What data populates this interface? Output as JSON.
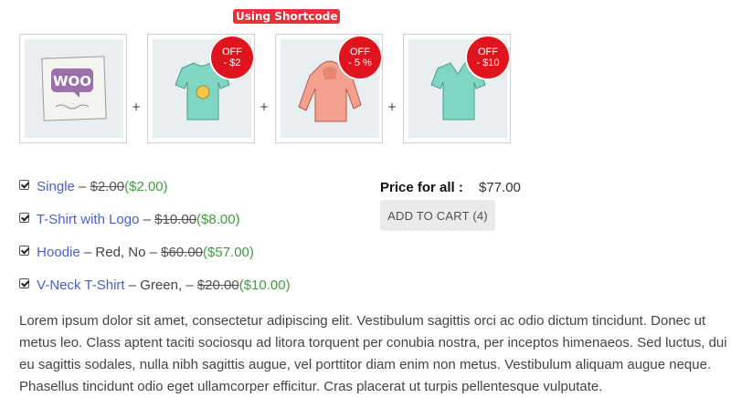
{
  "banner": "Using Shortcode",
  "products": [
    {
      "name": "Single",
      "image_icon": "woo-album-icon",
      "badge": null
    },
    {
      "name": "T-Shirt with Logo",
      "image_icon": "tshirt-logo-icon",
      "badge": {
        "line1": "OFF",
        "line2": "- $2"
      }
    },
    {
      "name": "Hoodie",
      "image_icon": "hoodie-icon",
      "badge": {
        "line1": "OFF",
        "line2": "- 5 %"
      }
    },
    {
      "name": "V-Neck T-Shirt",
      "image_icon": "vneck-tshirt-icon",
      "badge": {
        "line1": "OFF",
        "line2": "- $10"
      }
    }
  ],
  "plus": "+",
  "items": [
    {
      "name": "Single",
      "attrs": "",
      "old_price": "$2.00",
      "new_price": "($2.00)",
      "checked": true
    },
    {
      "name": "T-Shirt with Logo",
      "attrs": "",
      "old_price": "$10.00",
      "new_price": "($8.00)",
      "checked": true
    },
    {
      "name": "Hoodie",
      "attrs": "Red, No",
      "old_price": "$60.00",
      "new_price": "($57.00)",
      "checked": true
    },
    {
      "name": "V-Neck T-Shirt",
      "attrs": "Green,",
      "old_price": "$20.00",
      "new_price": "($10.00)",
      "checked": true
    }
  ],
  "separator": "–",
  "price_for_all_label": "Price for all :",
  "price_for_all_value": "$77.00",
  "add_to_cart_label": "ADD TO CART (4)",
  "description": "Lorem ipsum dolor sit amet, consectetur adipiscing elit. Vestibulum sagittis orci ac odio dictum tincidunt. Donec ut metus leo. Class aptent taciti sociosqu ad litora torquent per conubia nostra, per inceptos himenaeos. Sed luctus, dui eu sagittis sodales, nulla nibh sagittis augue, vel porttitor diam enim non metus. Vestibulum aliquam augue neque. Phasellus tincidunt odio eget ullamcorper efficitur. Cras placerat ut turpis pellentesque vulputate.",
  "colors": {
    "badge": "#e0141e",
    "link": "#4a60c9",
    "sale_price": "#3e9d3e",
    "banner": "#e8313b"
  }
}
